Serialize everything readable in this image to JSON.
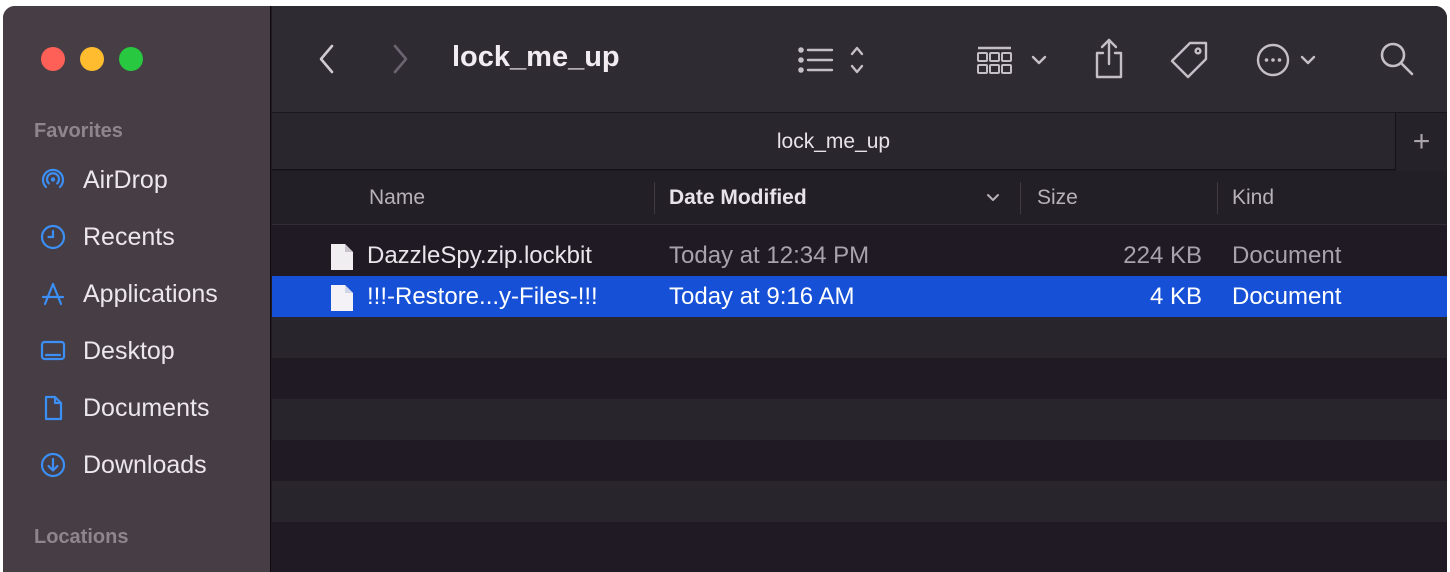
{
  "window": {
    "title": "lock_me_up"
  },
  "sidebar": {
    "favorites_title": "Favorites",
    "locations_title": "Locations",
    "items": [
      {
        "label": "AirDrop",
        "icon": "airdrop-icon"
      },
      {
        "label": "Recents",
        "icon": "clock-icon"
      },
      {
        "label": "Applications",
        "icon": "applications-icon"
      },
      {
        "label": "Desktop",
        "icon": "desktop-icon"
      },
      {
        "label": "Documents",
        "icon": "document-icon"
      },
      {
        "label": "Downloads",
        "icon": "download-icon"
      }
    ]
  },
  "tab": {
    "label": "lock_me_up",
    "new_tab": "+"
  },
  "columns": {
    "name": "Name",
    "date": "Date Modified",
    "size": "Size",
    "kind": "Kind"
  },
  "files": [
    {
      "name": "DazzleSpy.zip.lockbit",
      "date": "Today at 12:34 PM",
      "size": "224 KB",
      "kind": "Document"
    },
    {
      "name": "!!!-Restore...y-Files-!!!",
      "date": "Today at 9:16 AM",
      "size": "4 KB",
      "kind": "Document",
      "selected": true
    }
  ],
  "colors": {
    "accent": "#1550d6",
    "sidebar_icon": "#3b8ff5"
  }
}
